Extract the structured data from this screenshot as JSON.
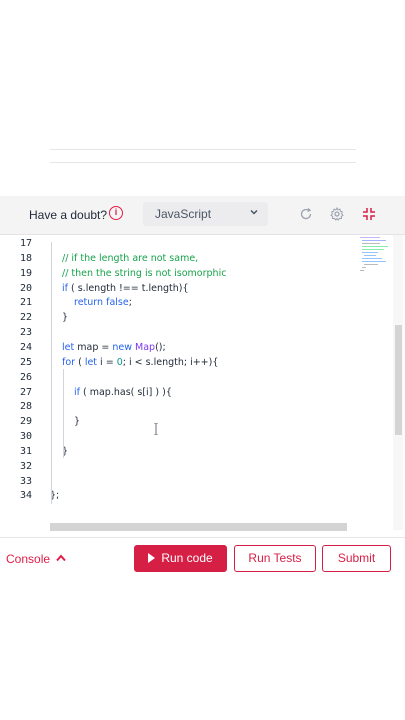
{
  "toolbar": {
    "doubt_label": "Have a doubt?",
    "language": "JavaScript",
    "icons": [
      "info-icon",
      "chevron-down-icon",
      "reset-icon",
      "settings-icon",
      "collapse-icon"
    ]
  },
  "editor": {
    "line_numbers": [
      "17",
      "18",
      "19",
      "20",
      "21",
      "22",
      "23",
      "24",
      "25",
      "26",
      "27",
      "28",
      "29",
      "30",
      "31",
      "32",
      "33",
      "34"
    ],
    "lines": [
      {
        "n": "17",
        "parts": []
      },
      {
        "n": "18",
        "parts": [
          {
            "t": "cm",
            "v": "// if the length are not same,"
          }
        ]
      },
      {
        "n": "19",
        "parts": [
          {
            "t": "cm",
            "v": "// then the string is not isomorphic"
          }
        ]
      },
      {
        "n": "20",
        "parts": [
          {
            "t": "kw",
            "v": "if"
          },
          {
            "t": "",
            "v": " ( s.length !== t.length){"
          }
        ]
      },
      {
        "n": "21",
        "parts": [
          {
            "t": "kw",
            "v": "return"
          },
          {
            "t": "",
            "v": " "
          },
          {
            "t": "kw",
            "v": "false"
          },
          {
            "t": "",
            "v": ";"
          }
        ]
      },
      {
        "n": "22",
        "parts": [
          {
            "t": "",
            "v": "}"
          }
        ]
      },
      {
        "n": "23",
        "parts": []
      },
      {
        "n": "24",
        "parts": [
          {
            "t": "kw",
            "v": "let"
          },
          {
            "t": "",
            "v": " map = "
          },
          {
            "t": "kw",
            "v": "new"
          },
          {
            "t": "",
            "v": " "
          },
          {
            "t": "cl",
            "v": "Map"
          },
          {
            "t": "",
            "v": "();"
          }
        ]
      },
      {
        "n": "25",
        "parts": [
          {
            "t": "kw",
            "v": "for"
          },
          {
            "t": "",
            "v": " ( "
          },
          {
            "t": "kw",
            "v": "let"
          },
          {
            "t": "",
            "v": " i = "
          },
          {
            "t": "nm",
            "v": "0"
          },
          {
            "t": "",
            "v": "; i < s.length; i++){"
          }
        ]
      },
      {
        "n": "26",
        "parts": []
      },
      {
        "n": "27",
        "parts": [
          {
            "t": "kw",
            "v": "if"
          },
          {
            "t": "",
            "v": " ( map.has( s[i] ) ){"
          }
        ]
      },
      {
        "n": "28",
        "parts": []
      },
      {
        "n": "29",
        "parts": [
          {
            "t": "",
            "v": "}"
          }
        ]
      },
      {
        "n": "30",
        "parts": []
      },
      {
        "n": "31",
        "parts": [
          {
            "t": "",
            "v": "}"
          }
        ]
      },
      {
        "n": "32",
        "parts": []
      },
      {
        "n": "33",
        "parts": []
      },
      {
        "n": "34",
        "parts": [
          {
            "t": "",
            "v": "};"
          }
        ]
      }
    ]
  },
  "bottom": {
    "console_label": "Console",
    "run_code_label": "Run code",
    "run_tests_label": "Run Tests",
    "submit_label": "Submit"
  },
  "colors": {
    "accent": "#d61f45",
    "comment": "#16a34a",
    "keyword": "#2563eb"
  }
}
